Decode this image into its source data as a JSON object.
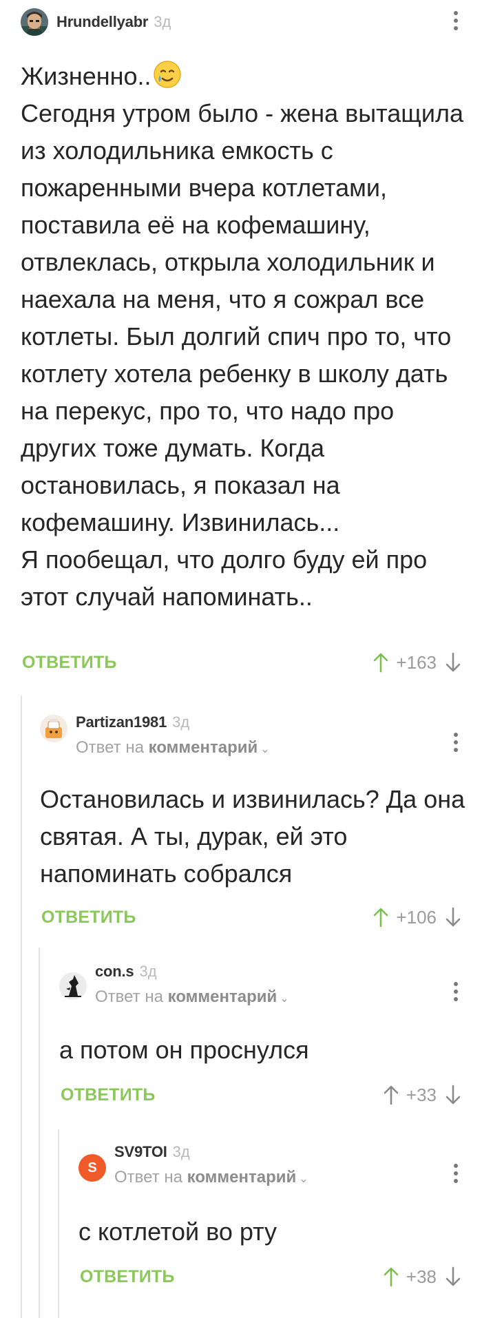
{
  "colors": {
    "accent_green": "#8ac858",
    "text": "#262626",
    "muted": "#a3a3a3",
    "thread_line": "#e3e3e3"
  },
  "labels": {
    "reply_to_prefix": "Ответ на",
    "reply_to_target": "комментарий",
    "reply_button": "ОТВЕТИТЬ"
  },
  "comments": [
    {
      "username": "Hrundellyabr",
      "time": "3д",
      "avatar_icon": "man-portrait-avatar",
      "text": "Жизненно..",
      "text_emoji": "smiling-face-with-tear-emoji",
      "text_rest": "Сегодня утром было - жена вытащила из холодильника емкость с пожаренными вчера котлетами, поставила её на кофемашину, отвлеклась, открыла холодильник и наехала на меня, что я сожрал все котлеты. Был долгий спич про то, что котлету хотела ребенку в школу дать на перекус, про то, что надо про других тоже думать. Когда остановилась, я показал на кофемашину. Извинилась...\nЯ пообещал, что долго буду ей про этот случай напоминать..",
      "score": "+163"
    },
    {
      "username": "Partizan1981",
      "time": "3д",
      "avatar_icon": "cartoon-figure-avatar",
      "text": "Остановилась и извинилась? Да она святая. А ты, дурак, ей это напоминать собрался",
      "score": "+106"
    },
    {
      "username": "con.s",
      "time": "3д",
      "avatar_icon": "silhouette-avatar",
      "text": "а потом он проснулся",
      "score": "+33"
    },
    {
      "username": "SV9TOI",
      "time": "3д",
      "avatar_icon": "letter-s-avatar",
      "avatar_letter": "S",
      "avatar_color": "#f05a28",
      "text": "с котлетой во рту",
      "score": "+38"
    }
  ]
}
